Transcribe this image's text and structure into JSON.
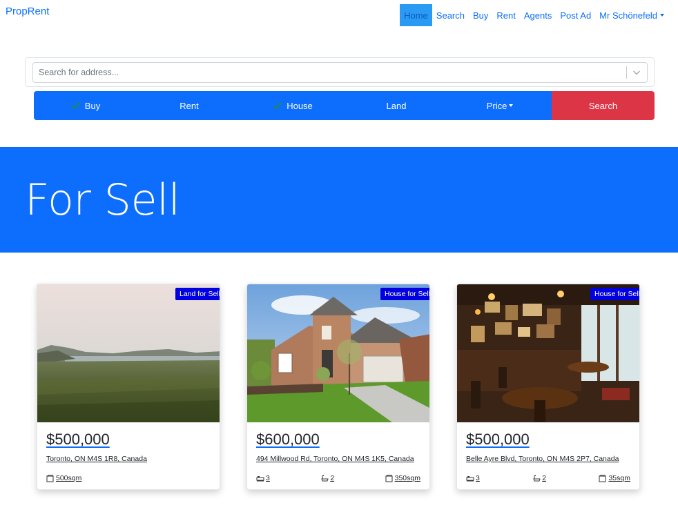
{
  "brand": "PropRent",
  "nav": {
    "home": "Home",
    "search": "Search",
    "buy": "Buy",
    "rent": "Rent",
    "agents": "Agents",
    "post_ad": "Post Ad",
    "user": "Mr Schönefeld"
  },
  "search": {
    "placeholder": "Search for address..."
  },
  "filters": {
    "buy": "Buy",
    "rent": "Rent",
    "house": "House",
    "land": "Land",
    "price": "Price",
    "search": "Search"
  },
  "hero": {
    "title": "For Sell"
  },
  "listings": [
    {
      "badge": "Land for Sell",
      "price": "$500,000",
      "address": "Toronto, ON M4S 1R8, Canada",
      "area": "500sqm"
    },
    {
      "badge": "House for Sell",
      "price": "$600,000",
      "address": "494 Millwood Rd, Toronto, ON M4S 1K5, Canada",
      "beds": "3",
      "baths": "2",
      "area": "350sqm"
    },
    {
      "badge": "House for Sell",
      "price": "$500,000",
      "address": "Belle Ayre Blvd, Toronto, ON M4S 2P7, Canada",
      "beds": "3",
      "baths": "2",
      "area": "35sqm"
    }
  ],
  "colors": {
    "primary": "#0d6efd",
    "danger": "#dc3545",
    "badge": "#0000e0"
  }
}
